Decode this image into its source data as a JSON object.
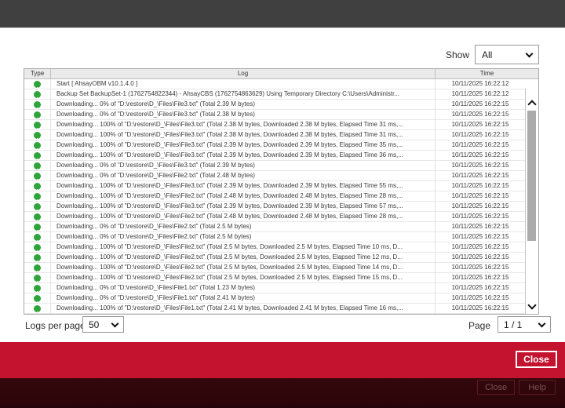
{
  "filter": {
    "label": "Show",
    "value": "All"
  },
  "table": {
    "columns": {
      "type": "Type",
      "log": "Log",
      "time": "Time"
    },
    "rows": [
      {
        "icon": "info",
        "log": "Start [ AhsayOBM v10.1.4.0 ]",
        "time": "10/11/2025 16:22:12"
      },
      {
        "icon": "info",
        "log": "Backup Set BackupSet-1 (1762754822344) - AhsayCBS (1762754863629) Using Temporary Directory C:\\Users\\Administr...",
        "time": "10/11/2025 16:22:12"
      },
      {
        "icon": "info",
        "log": "Downloading... 0% of \"D:\\restore\\D_\\Files\\File3.txt\" (Total 2.39 M bytes)",
        "time": "10/11/2025 16:22:15"
      },
      {
        "icon": "info",
        "log": "Downloading... 0% of \"D:\\restore\\D_\\Files\\File3.txt\" (Total 2.38 M bytes)",
        "time": "10/11/2025 16:22:15"
      },
      {
        "icon": "info",
        "log": "Downloading... 100% of \"D:\\restore\\D_\\Files\\File3.txt\" (Total 2.38 M bytes, Downloaded 2.38 M bytes, Elapsed Time 31 ms,...",
        "time": "10/11/2025 16:22:15"
      },
      {
        "icon": "info",
        "log": "Downloading... 100% of \"D:\\restore\\D_\\Files\\File3.txt\" (Total 2.38 M bytes, Downloaded 2.38 M bytes, Elapsed Time 31 ms,...",
        "time": "10/11/2025 16:22:15"
      },
      {
        "icon": "info",
        "log": "Downloading... 100% of \"D:\\restore\\D_\\Files\\File3.txt\" (Total 2.39 M bytes, Downloaded 2.39 M bytes, Elapsed Time 35 ms,...",
        "time": "10/11/2025 16:22:15"
      },
      {
        "icon": "info",
        "log": "Downloading... 100% of \"D:\\restore\\D_\\Files\\File3.txt\" (Total 2.39 M bytes, Downloaded 2.39 M bytes, Elapsed Time 36 ms,...",
        "time": "10/11/2025 16:22:15"
      },
      {
        "icon": "info",
        "log": "Downloading... 0% of \"D:\\restore\\D_\\Files\\File3.txt\" (Total 2.39 M bytes)",
        "time": "10/11/2025 16:22:15"
      },
      {
        "icon": "info",
        "log": "Downloading... 0% of \"D:\\restore\\D_\\Files\\File2.txt\" (Total 2.48 M bytes)",
        "time": "10/11/2025 16:22:15"
      },
      {
        "icon": "info",
        "log": "Downloading... 100% of \"D:\\restore\\D_\\Files\\File3.txt\" (Total 2.39 M bytes, Downloaded 2.39 M bytes, Elapsed Time 55 ms,...",
        "time": "10/11/2025 16:22:15"
      },
      {
        "icon": "info",
        "log": "Downloading... 100% of \"D:\\restore\\D_\\Files\\File2.txt\" (Total 2.48 M bytes, Downloaded 2.48 M bytes, Elapsed Time 28 ms,...",
        "time": "10/11/2025 16:22:15"
      },
      {
        "icon": "info",
        "log": "Downloading... 100% of \"D:\\restore\\D_\\Files\\File3.txt\" (Total 2.39 M bytes, Downloaded 2.39 M bytes, Elapsed Time 57 ms,...",
        "time": "10/11/2025 16:22:15"
      },
      {
        "icon": "info",
        "log": "Downloading... 100% of \"D:\\restore\\D_\\Files\\File2.txt\" (Total 2.48 M bytes, Downloaded 2.48 M bytes, Elapsed Time 28 ms,...",
        "time": "10/11/2025 16:22:15"
      },
      {
        "icon": "info",
        "log": "Downloading... 0% of \"D:\\restore\\D_\\Files\\File2.txt\" (Total 2.5 M bytes)",
        "time": "10/11/2025 16:22:15"
      },
      {
        "icon": "info",
        "log": "Downloading... 0% of \"D:\\restore\\D_\\Files\\File2.txt\" (Total 2.5 M bytes)",
        "time": "10/11/2025 16:22:15"
      },
      {
        "icon": "info",
        "log": "Downloading... 100% of \"D:\\restore\\D_\\Files\\File2.txt\" (Total 2.5 M bytes, Downloaded 2.5 M bytes, Elapsed Time 10 ms, D...",
        "time": "10/11/2025 16:22:15"
      },
      {
        "icon": "info",
        "log": "Downloading... 100% of \"D:\\restore\\D_\\Files\\File2.txt\" (Total 2.5 M bytes, Downloaded 2.5 M bytes, Elapsed Time 12 ms, D...",
        "time": "10/11/2025 16:22:15"
      },
      {
        "icon": "info",
        "log": "Downloading... 100% of \"D:\\restore\\D_\\Files\\File2.txt\" (Total 2.5 M bytes, Downloaded 2.5 M bytes, Elapsed Time 14 ms, D...",
        "time": "10/11/2025 16:22:15"
      },
      {
        "icon": "info",
        "log": "Downloading... 100% of \"D:\\restore\\D_\\Files\\File2.txt\" (Total 2.5 M bytes, Downloaded 2.5 M bytes, Elapsed Time 15 ms, D...",
        "time": "10/11/2025 16:22:15"
      },
      {
        "icon": "info",
        "log": "Downloading... 0% of \"D:\\restore\\D_\\Files\\File1.txt\" (Total 1.23 M bytes)",
        "time": "10/11/2025 16:22:15"
      },
      {
        "icon": "info",
        "log": "Downloading... 0% of \"D:\\restore\\D_\\Files\\File1.txt\" (Total 2.41 M bytes)",
        "time": "10/11/2025 16:22:15"
      },
      {
        "icon": "info",
        "log": "Downloading... 100% of \"D:\\restore\\D_\\Files\\File1.txt\" (Total 2.41 M bytes, Downloaded 2.41 M bytes, Elapsed Time 16 ms,...",
        "time": "10/11/2025 16:22:15"
      }
    ]
  },
  "pagination": {
    "logs_per_page_label": "Logs per page",
    "logs_per_page_value": "50",
    "page_label": "Page",
    "page_value": "1 / 1"
  },
  "dialog_footer": {
    "close_label": "Close"
  },
  "background_window": {
    "close_label": "Close",
    "help_label": "Help"
  },
  "colors": {
    "accent_red": "#c3132e",
    "dark_maroon": "#2e060a",
    "titlebar_gray": "#404040",
    "info_green": "#2ea43a"
  }
}
